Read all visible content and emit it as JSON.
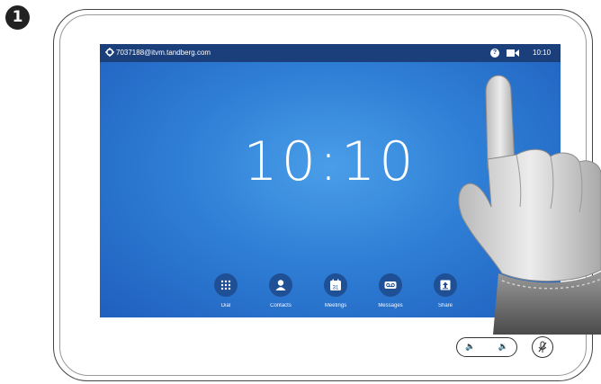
{
  "step": "1",
  "status_bar": {
    "address": "7037188@itvm.tandberg.com",
    "help_glyph": "?",
    "time": "10:10"
  },
  "clock": "10:10",
  "dock": [
    {
      "label": "Dial",
      "icon": "dial-pad-icon"
    },
    {
      "label": "Contacts",
      "icon": "person-icon"
    },
    {
      "label": "Meetings",
      "icon": "calendar-icon",
      "icon_text": "31"
    },
    {
      "label": "Messages",
      "icon": "voicemail-icon"
    },
    {
      "label": "Share",
      "icon": "share-icon"
    }
  ],
  "colors": {
    "status_bar": "#1b3f7a",
    "screen_center": "#4a9ee8",
    "screen_edge": "#1f5fbd",
    "dock_icon": "#1f4f95"
  }
}
